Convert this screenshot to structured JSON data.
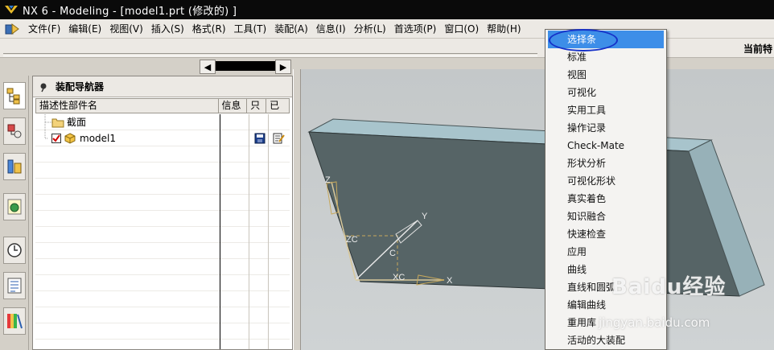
{
  "window": {
    "title": "NX 6 - Modeling - [model1.prt  (修改的) ]"
  },
  "menubar": {
    "items": [
      "文件(F)",
      "编辑(E)",
      "视图(V)",
      "插入(S)",
      "格式(R)",
      "工具(T)",
      "装配(A)",
      "信息(I)",
      "分析(L)",
      "首选项(P)",
      "窗口(O)",
      "帮助(H)"
    ]
  },
  "toolbar": {
    "current_label": "当前特"
  },
  "navigator": {
    "title": "装配导航器",
    "columns": [
      "描述性部件名",
      "信息",
      "只",
      "已"
    ],
    "tree": [
      {
        "label": "截面",
        "icon": "folder-icon"
      },
      {
        "label": "model1",
        "icon": "part-cube-icon",
        "checked": true
      }
    ]
  },
  "dropdown": {
    "items": [
      "选择条",
      "标准",
      "视图",
      "可视化",
      "实用工具",
      "操作记录",
      "Check-Mate",
      "形状分析",
      "可视化形状",
      "真实着色",
      "知识融合",
      "快速检查",
      "应用",
      "曲线",
      "直线和圆弧",
      "编辑曲线",
      "重用库",
      "活动的大装配"
    ],
    "selected_index": 0
  },
  "viewport": {
    "axis_labels": {
      "z": "Z",
      "y": "Y",
      "x": "X",
      "zc": "ZC",
      "c": "C",
      "xc": "XC"
    }
  },
  "watermark": {
    "text": "Baidu经验",
    "url": "jingyan.baidu.com"
  },
  "colors": {
    "accent": "#3d8ee8",
    "annotation": "#1631c8",
    "solid": "#566466",
    "solid_top": "#a8c4cc"
  }
}
